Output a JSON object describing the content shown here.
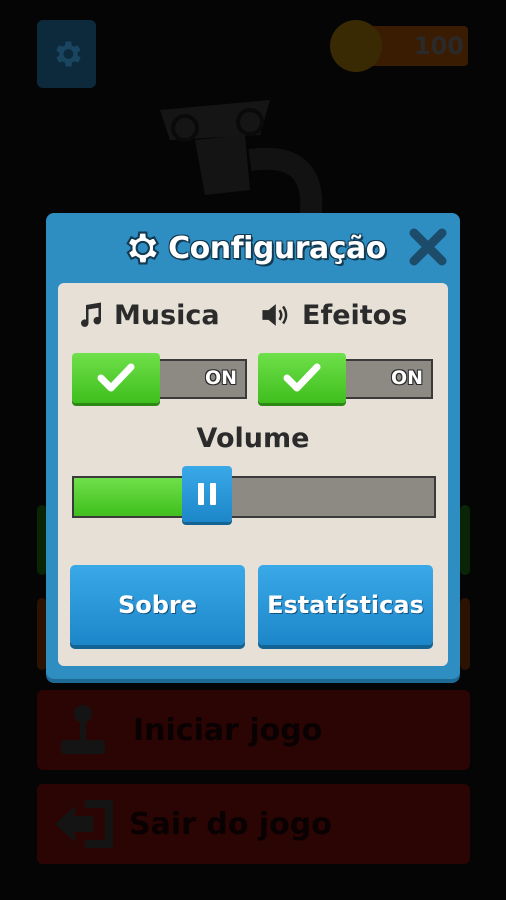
{
  "background": {
    "coins": "100",
    "buttons": [
      {
        "label": "Iniciar jogo",
        "icon": "joystick-icon",
        "color": "#2b0404"
      },
      {
        "label": "Sair do jogo",
        "icon": "exit-icon",
        "color": "#2b0404"
      }
    ]
  },
  "dialog": {
    "title": "Configuração",
    "title_icon": "gear-icon",
    "close_icon": "close-icon",
    "music": {
      "label": "Musica",
      "icon": "music-note-icon",
      "state": "ON"
    },
    "effects": {
      "label": "Efeitos",
      "icon": "speaker-icon",
      "state": "ON"
    },
    "volume": {
      "label": "Volume",
      "value": 0.37
    },
    "buttons": {
      "about": "Sobre",
      "stats": "Estatísticas"
    },
    "colors": {
      "frame": "#2e8ec2",
      "panel": "#e6e0d6",
      "toggle_on": "#4fcf2a",
      "button": "#2a98d8"
    }
  }
}
